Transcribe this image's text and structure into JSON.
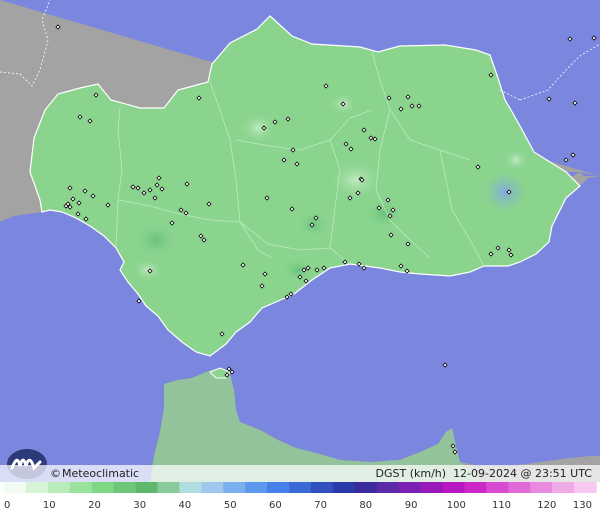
{
  "brand": {
    "copyright_symbol": "©",
    "name": "Meteoclimatic",
    "logo_icon": "meteoclimatic-logo-icon"
  },
  "variable_label": "DGST (km/h)",
  "timestamp": "12-09-2024 @ 23:51 UTC",
  "colors": {
    "sea": "#7b87de",
    "land_outside": "#a3a3a3",
    "region_green": "#8ad48e",
    "border": "#ffffff",
    "station_marker": "#000000"
  },
  "colorbar": {
    "ticks": [
      "0",
      "10",
      "20",
      "30",
      "40",
      "50",
      "60",
      "70",
      "80",
      "90",
      "100",
      "110",
      "120",
      "130"
    ],
    "colors": [
      "#f2fbf2",
      "#d6f5d6",
      "#b8ecba",
      "#9ae39e",
      "#7fd886",
      "#6cc878",
      "#5fb86e",
      "#8acb9e",
      "#b0dde0",
      "#a0c8ec",
      "#7ab0f0",
      "#5c98ee",
      "#4680ea",
      "#3a6ad6",
      "#3050c0",
      "#2a3aa8",
      "#3a2a9c",
      "#5a2aa8",
      "#7a20b4",
      "#9a1ab8",
      "#b818c0",
      "#cc28c8",
      "#d84ad0",
      "#e06ad8",
      "#e88ae0",
      "#f0aae8",
      "#f8c8f0"
    ]
  },
  "stations": [
    [
      58,
      27
    ],
    [
      570,
      39
    ],
    [
      594,
      38
    ],
    [
      491,
      75
    ],
    [
      96,
      95
    ],
    [
      199,
      98
    ],
    [
      326,
      86
    ],
    [
      549,
      99
    ],
    [
      575,
      103
    ],
    [
      389,
      98
    ],
    [
      408,
      97
    ],
    [
      412,
      106
    ],
    [
      419,
      106
    ],
    [
      401,
      109
    ],
    [
      80,
      117
    ],
    [
      90,
      121
    ],
    [
      275,
      122
    ],
    [
      288,
      119
    ],
    [
      264,
      128
    ],
    [
      343,
      104
    ],
    [
      364,
      130
    ],
    [
      371,
      138
    ],
    [
      375,
      139
    ],
    [
      346,
      144
    ],
    [
      293,
      150
    ],
    [
      351,
      149
    ],
    [
      284,
      160
    ],
    [
      297,
      164
    ],
    [
      573,
      155
    ],
    [
      566,
      160
    ],
    [
      478,
      167
    ],
    [
      133,
      187
    ],
    [
      159,
      178
    ],
    [
      157,
      185
    ],
    [
      70,
      188
    ],
    [
      93,
      196
    ],
    [
      85,
      191
    ],
    [
      73,
      199
    ],
    [
      79,
      203
    ],
    [
      70,
      207
    ],
    [
      66,
      206
    ],
    [
      68,
      204
    ],
    [
      108,
      205
    ],
    [
      78,
      214
    ],
    [
      86,
      219
    ],
    [
      138,
      188
    ],
    [
      150,
      190
    ],
    [
      144,
      193
    ],
    [
      162,
      189
    ],
    [
      187,
      184
    ],
    [
      181,
      210
    ],
    [
      186,
      213
    ],
    [
      209,
      204
    ],
    [
      155,
      198
    ],
    [
      267,
      198
    ],
    [
      350,
      198
    ],
    [
      361,
      179
    ],
    [
      362,
      180
    ],
    [
      358,
      193
    ],
    [
      388,
      200
    ],
    [
      379,
      208
    ],
    [
      393,
      210
    ],
    [
      390,
      216
    ],
    [
      316,
      218
    ],
    [
      292,
      209
    ],
    [
      312,
      225
    ],
    [
      201,
      236
    ],
    [
      204,
      240
    ],
    [
      172,
      223
    ],
    [
      509,
      192
    ],
    [
      408,
      244
    ],
    [
      391,
      235
    ],
    [
      509,
      250
    ],
    [
      498,
      248
    ],
    [
      511,
      255
    ],
    [
      491,
      254
    ],
    [
      243,
      265
    ],
    [
      265,
      274
    ],
    [
      304,
      270
    ],
    [
      308,
      268
    ],
    [
      300,
      277
    ],
    [
      317,
      270
    ],
    [
      324,
      268
    ],
    [
      306,
      281
    ],
    [
      291,
      294
    ],
    [
      287,
      297
    ],
    [
      262,
      286
    ],
    [
      345,
      262
    ],
    [
      359,
      264
    ],
    [
      364,
      268
    ],
    [
      401,
      266
    ],
    [
      407,
      271
    ],
    [
      150,
      271
    ],
    [
      139,
      301
    ],
    [
      222,
      334
    ],
    [
      229,
      369
    ],
    [
      232,
      372
    ],
    [
      227,
      375
    ],
    [
      445,
      365
    ],
    [
      453,
      446
    ],
    [
      455,
      452
    ]
  ]
}
